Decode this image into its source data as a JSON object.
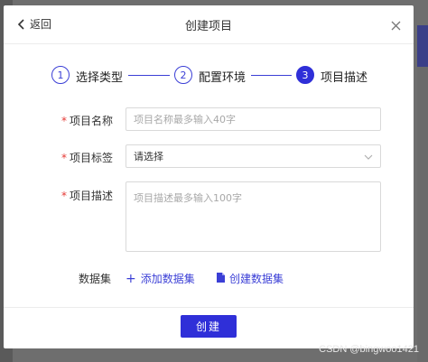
{
  "dialog": {
    "back_label": "返回",
    "title": "创建项目",
    "close_icon": "close-icon"
  },
  "steps": [
    {
      "number": "1",
      "label": "选择类型",
      "state": "done"
    },
    {
      "number": "2",
      "label": "配置环境",
      "state": "done"
    },
    {
      "number": "3",
      "label": "项目描述",
      "state": "active"
    }
  ],
  "form": {
    "name": {
      "label": "项目名称",
      "required": "*",
      "placeholder": "项目名称最多输入40字"
    },
    "tags": {
      "label": "项目标签",
      "required": "*",
      "value": "请选择"
    },
    "description": {
      "label": "项目描述",
      "required": "*",
      "placeholder": "项目描述最多输入100字"
    },
    "dataset": {
      "label": "数据集",
      "add_label": "添加数据集",
      "create_label": "创建数据集"
    }
  },
  "footer": {
    "create_label": "创建"
  },
  "watermark": "CSDN @bingwoo1421",
  "colors": {
    "primary": "#2f2fd8",
    "required": "#e53935"
  }
}
